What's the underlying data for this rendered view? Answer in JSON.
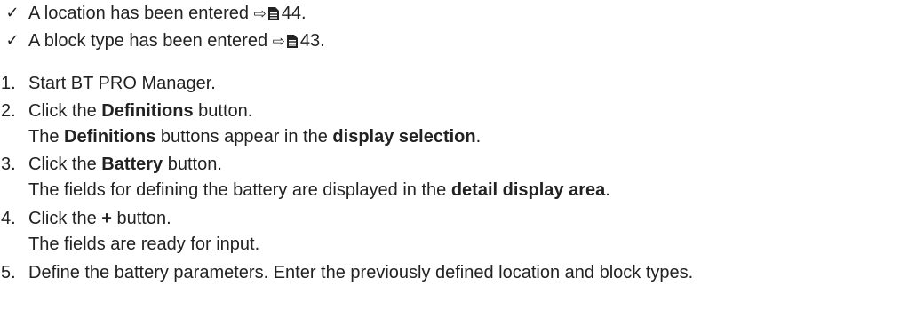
{
  "prerequisites": [
    {
      "text": "A location has been entered",
      "page": "44."
    },
    {
      "text": "A block type has been entered",
      "page": "43."
    }
  ],
  "steps": [
    {
      "number": "1.",
      "text": "Start BT PRO Manager."
    },
    {
      "number": "2.",
      "pre": "Click the ",
      "bold": "Definitions",
      "post": " button.",
      "result": {
        "a": "The ",
        "b1": "Definitions",
        "c": " buttons appear in the ",
        "b2": "display selection",
        "d": "."
      }
    },
    {
      "number": "3.",
      "pre": "Click the ",
      "bold": "Battery",
      "post": " button.",
      "result": {
        "a": "The fields for defining the battery are displayed in the ",
        "b": "detail display area",
        "c": "."
      }
    },
    {
      "number": "4.",
      "pre": "Click the ",
      "bold": "+",
      "post": " button.",
      "result": "The fields are ready for input."
    },
    {
      "number": "5.",
      "text": "Define the battery parameters. Enter the previously defined location and block types."
    }
  ],
  "icons": {
    "check": "checkmark-icon",
    "arrow": "arrow-right-icon",
    "page": "page-icon"
  }
}
